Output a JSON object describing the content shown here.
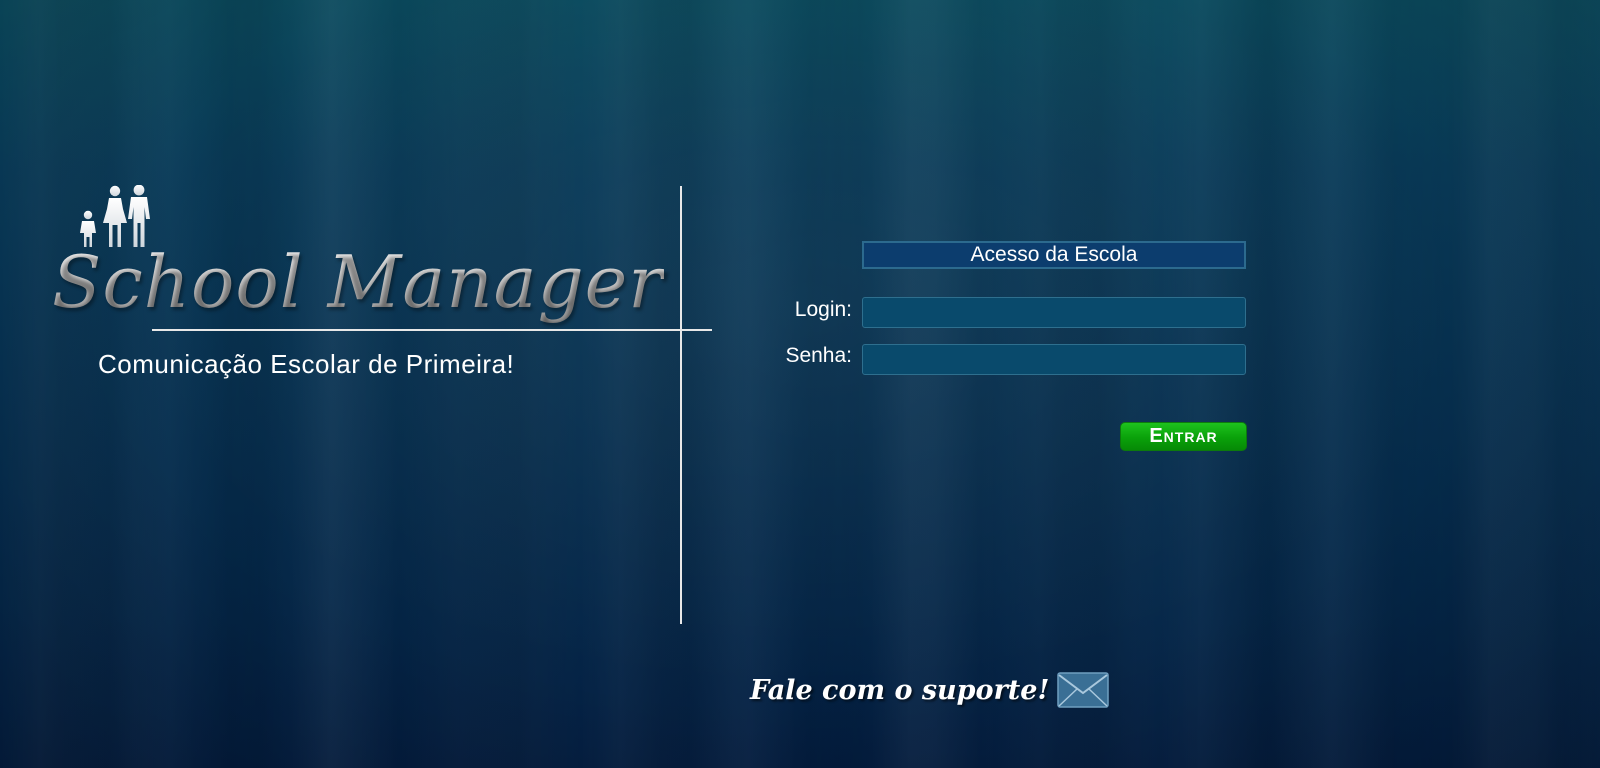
{
  "brand": {
    "title": "School Manager",
    "tagline": "Comunicação Escolar de Primeira!",
    "logo_icon": "family-icon"
  },
  "login": {
    "header": "Acesso da Escola",
    "login_label": "Login:",
    "login_value": "",
    "password_label": "Senha:",
    "password_value": "",
    "submit_label": "Entrar"
  },
  "support": {
    "text": "Fale com o suporte!",
    "icon": "mail-icon"
  },
  "colors": {
    "background": "#063050",
    "header_bg": "#0c3d6e",
    "input_bg": "#094a6c",
    "button_green": "#0aa10a",
    "text": "#ffffff"
  }
}
